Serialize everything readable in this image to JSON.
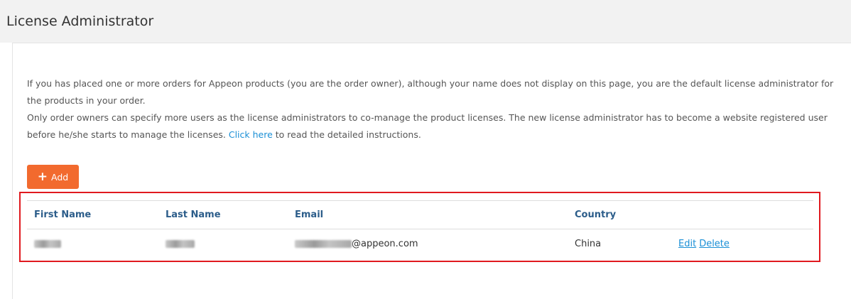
{
  "page": {
    "title": "License Administrator"
  },
  "intro": {
    "paragraph1": "If you has placed one or more orders for Appeon products (you are the order owner), although your name does not display on this page, you are the default license administrator for the products in your order.",
    "paragraph2_before_link": "Only order owners can specify more users as the license administrators to co-manage the product licenses. The new license administrator has to become a website registered user before he/she starts to manage the licenses. ",
    "link_text": "Click here",
    "paragraph2_after_link": " to read the detailed instructions."
  },
  "add_button": {
    "label": "Add"
  },
  "table": {
    "headers": {
      "first_name": "First Name",
      "last_name": "Last Name",
      "email": "Email",
      "country": "Country"
    },
    "rows": [
      {
        "first_name": "[redacted]",
        "last_name": "[redacted]",
        "email_domain": "@appeon.com",
        "country": "China",
        "edit_label": "Edit",
        "delete_label": "Delete"
      }
    ]
  },
  "colors": {
    "add_button": "#f26a2e",
    "link": "#1a8fd6",
    "header_text": "#2c5d8a",
    "highlight_border": "#e0191f"
  },
  "icons": {
    "add": "plus-icon"
  }
}
